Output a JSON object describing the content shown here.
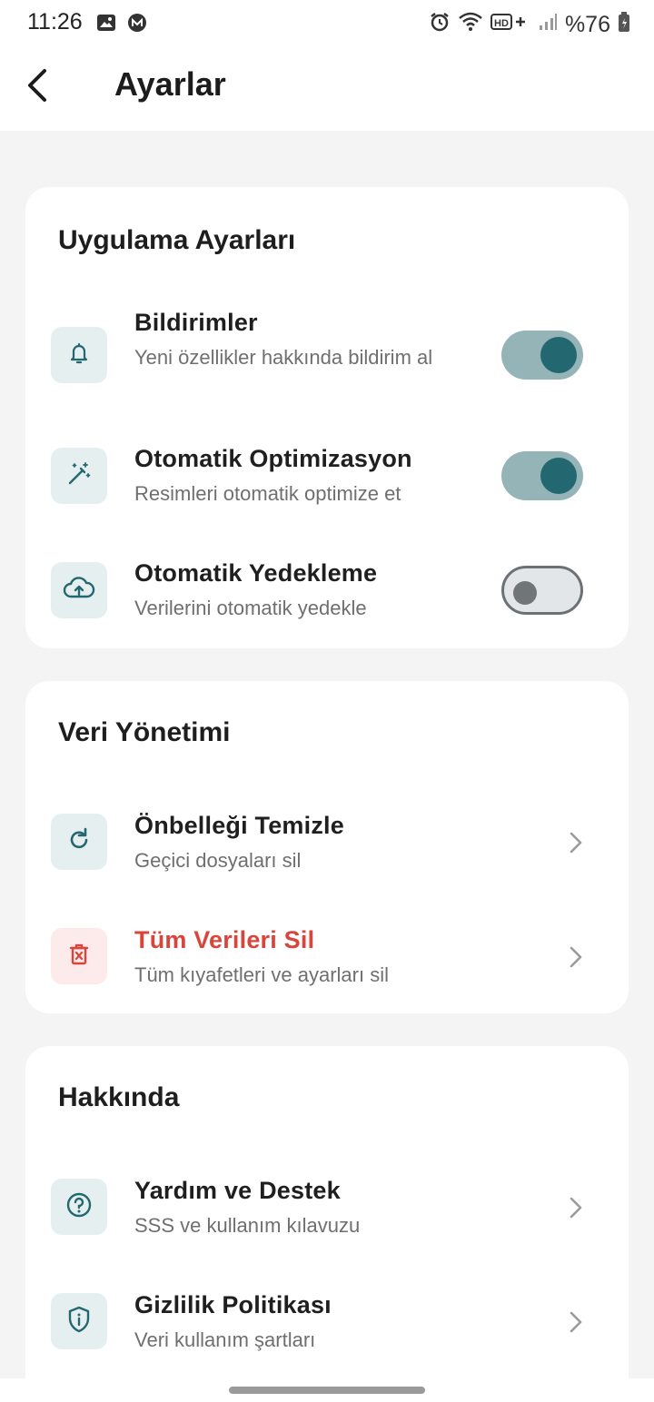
{
  "status_bar": {
    "time": "11:26",
    "battery": "%76",
    "icons": [
      "image-icon",
      "m-app-icon",
      "alarm-icon",
      "wifi-icon",
      "hd-plus-icon",
      "signal-icon",
      "battery-icon"
    ]
  },
  "header": {
    "title": "Ayarlar",
    "back_icon": "back-arrow-icon"
  },
  "colors": {
    "accent": "#236770",
    "toggle_track_on": "#94b4b8",
    "danger": "#d9453b",
    "icon_bg": "#e6eff0",
    "danger_icon_bg": "#fdeaea",
    "background": "#f4f4f5"
  },
  "sections": [
    {
      "title": "Uygulama Ayarları",
      "items": [
        {
          "icon": "bell-icon",
          "title": "Bildirimler",
          "subtitle": "Yeni özellikler hakkında bildirim al",
          "control": "toggle",
          "enabled": true
        },
        {
          "icon": "magic-wand-icon",
          "title": "Otomatik Optimizasyon",
          "subtitle": "Resimleri otomatik optimize et",
          "control": "toggle",
          "enabled": true
        },
        {
          "icon": "cloud-upload-icon",
          "title": "Otomatik Yedekleme",
          "subtitle": "Verilerini otomatik yedekle",
          "control": "toggle",
          "enabled": false
        }
      ]
    },
    {
      "title": "Veri Yönetimi",
      "items": [
        {
          "icon": "refresh-icon",
          "title": "Önbelleği Temizle",
          "subtitle": "Geçici dosyaları sil",
          "control": "chevron"
        },
        {
          "icon": "trash-icon",
          "title": "Tüm Verileri Sil",
          "subtitle": "Tüm kıyafetleri ve ayarları sil",
          "control": "chevron",
          "danger": true
        }
      ]
    },
    {
      "title": "Hakkında",
      "items": [
        {
          "icon": "help-circle-icon",
          "title": "Yardım ve Destek",
          "subtitle": "SSS ve kullanım kılavuzu",
          "control": "chevron"
        },
        {
          "icon": "shield-info-icon",
          "title": "Gizlilik Politikası",
          "subtitle": "Veri kullanım şartları",
          "control": "chevron"
        }
      ]
    }
  ]
}
